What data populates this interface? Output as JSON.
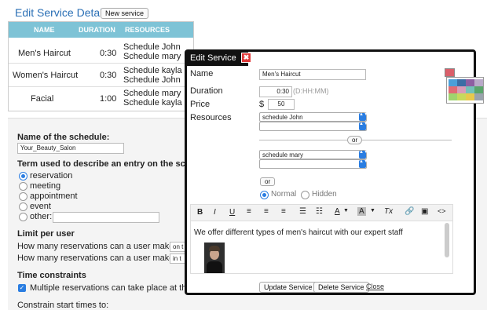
{
  "page": {
    "title": "Edit Service Details",
    "new_service": "New service"
  },
  "table": {
    "headers": [
      "NAME",
      "DURATION",
      "RESOURCES"
    ],
    "rows": [
      {
        "name": "Men's Haircut",
        "duration": "0:30",
        "res1": "Schedule John",
        "res2": "Schedule mary"
      },
      {
        "name": "Women's Haircut",
        "duration": "0:30",
        "res1": "Schedule kayla",
        "res2": "Schedule John"
      },
      {
        "name": "Facial",
        "duration": "1:00",
        "res1": "Schedule mary",
        "res2": "Schedule kayla"
      }
    ]
  },
  "form": {
    "schedule_name_label": "Name of the schedule:",
    "schedule_name_value": "Your_Beauty_Salon",
    "term_label": "Term used to describe an entry on the schedule",
    "terms": [
      "reservation",
      "meeting",
      "appointment",
      "event",
      "other:"
    ],
    "limit_label": "Limit per user",
    "limit_q1": "How many reservations can a user make",
    "limit_q1_value": "on t",
    "limit_q2": "How many reservations can a user make",
    "limit_q2_value": "in t",
    "time_label": "Time constraints",
    "time_check": "Multiple reservations can take place at the",
    "constrain_label": "Constrain start times to:"
  },
  "dialog": {
    "title": "Edit Service",
    "close_x": "✖",
    "name_label": "Name",
    "name_value": "Men's Haircut",
    "duration_label": "Duration",
    "duration_value": "0:30",
    "duration_hint": "(D:HH:MM)",
    "price_label": "Price",
    "currency": "$",
    "price_value": "50",
    "resources_label": "Resources",
    "resource1": "schedule John",
    "or1": "or",
    "resource2": "schedule mary",
    "or2": "or",
    "vis_normal": "Normal",
    "vis_hidden": "Hidden",
    "toolbar": {
      "bold": "B",
      "italic": "I",
      "underline": "U",
      "font_color": "A",
      "bg_color": "A",
      "clear": "Tx"
    },
    "description": "We offer different types of men's haircut with our expert staff",
    "update": "Update Service",
    "delete": "Delete Service",
    "close": "Close"
  },
  "colors": {
    "accent": "#2a7de1",
    "header": "#7ec3d6",
    "title": "#2a6fb5",
    "close_red": "#e03a3a"
  }
}
